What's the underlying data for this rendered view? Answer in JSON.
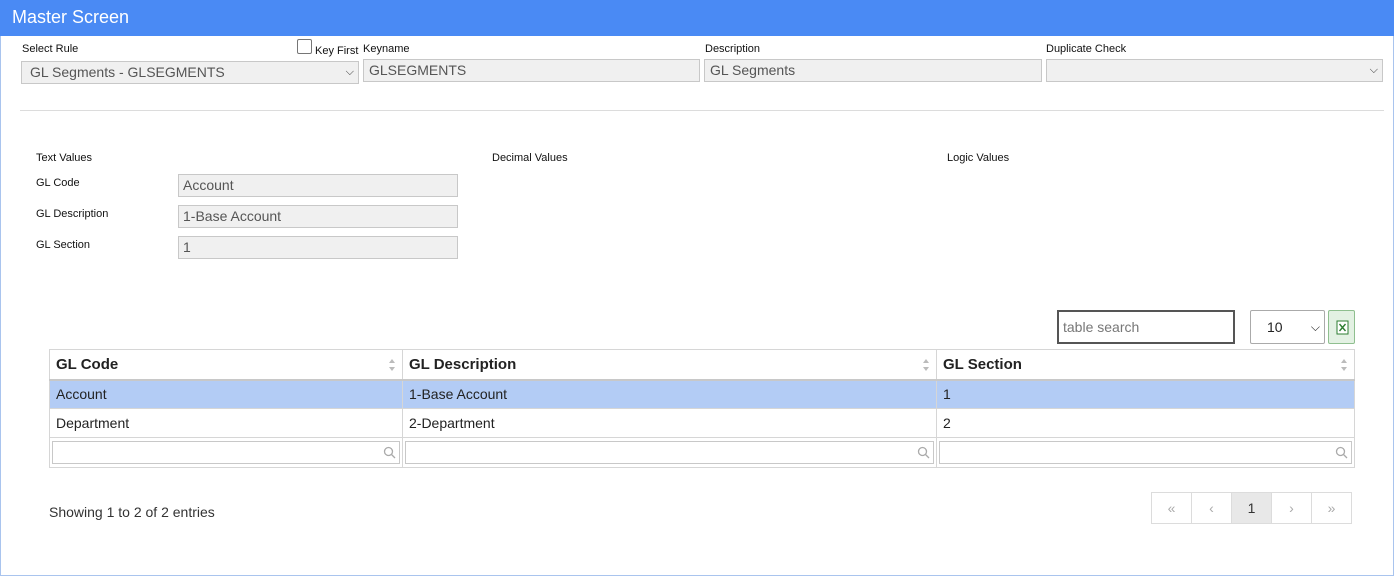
{
  "window": {
    "title": "Master Screen"
  },
  "header": {
    "select_rule_label": "Select Rule",
    "select_rule_value": "GL Segments - GLSEGMENTS",
    "key_first_label": "Key First",
    "keyname_label": "Keyname",
    "keyname_value": "GLSEGMENTS",
    "description_label": "Description",
    "description_value": "GL Segments",
    "duplicate_check_label": "Duplicate Check",
    "duplicate_check_value": ""
  },
  "sections": {
    "text_values": "Text Values",
    "decimal_values": "Decimal Values",
    "logic_values": "Logic Values"
  },
  "fields": [
    {
      "label": "GL Code",
      "value": "Account"
    },
    {
      "label": "GL Description",
      "value": "1-Base Account"
    },
    {
      "label": "GL Section",
      "value": "1"
    }
  ],
  "table": {
    "search_placeholder": "table search",
    "page_length": "10",
    "columns": [
      "GL Code",
      "GL Description",
      "GL Section"
    ],
    "rows": [
      [
        "Account",
        "1-Base Account",
        "1"
      ],
      [
        "Department",
        "2-Department",
        "2"
      ]
    ],
    "selected_row": 0,
    "info": "Showing 1 to 2 of 2 entries",
    "pager": {
      "first": "«",
      "prev": "‹",
      "current": "1",
      "next": "›",
      "last": "»"
    }
  },
  "colors": {
    "titlebar": "#4a8af4",
    "selected_row": "#b3ccf5"
  }
}
